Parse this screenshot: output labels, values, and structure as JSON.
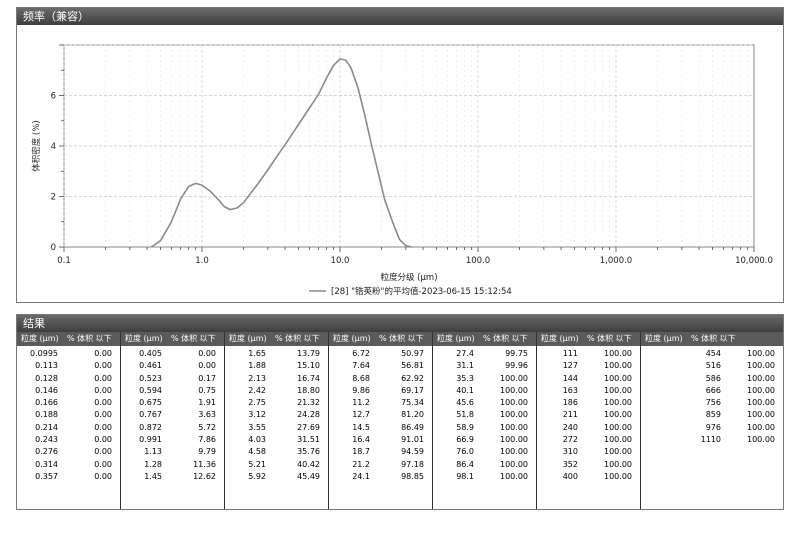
{
  "freq_panel": {
    "title": "频率（兼容）"
  },
  "chart_data": {
    "type": "line",
    "xscale": "log",
    "xlim": [
      0.1,
      10000.0
    ],
    "ylim": [
      0,
      8
    ],
    "xlabel": "粒度分级 (μm)",
    "ylabel": "体积密度 (%)",
    "x_ticks": [
      "0.1",
      "1.0",
      "10.0",
      "100.0",
      "1,000.0",
      "10,000.0"
    ],
    "y_ticks": [
      "0",
      "2",
      "4",
      "6"
    ],
    "grid": true,
    "legend": {
      "position": "bottom",
      "entries": [
        "[28] \"锆英粉\"的平均值-2023-06-15 15:12:54"
      ]
    },
    "series": [
      {
        "name": "[28] \"锆英粉\"的平均值-2023-06-15 15:12:54",
        "color": "#8a8a8a",
        "points": [
          [
            0.43,
            0
          ],
          [
            0.5,
            0.25
          ],
          [
            0.6,
            1.0
          ],
          [
            0.7,
            1.9
          ],
          [
            0.8,
            2.4
          ],
          [
            0.9,
            2.52
          ],
          [
            1.0,
            2.45
          ],
          [
            1.15,
            2.2
          ],
          [
            1.3,
            1.9
          ],
          [
            1.45,
            1.6
          ],
          [
            1.6,
            1.48
          ],
          [
            1.8,
            1.55
          ],
          [
            2.0,
            1.75
          ],
          [
            2.5,
            2.45
          ],
          [
            3.0,
            3.05
          ],
          [
            3.5,
            3.6
          ],
          [
            4.0,
            4.05
          ],
          [
            5.0,
            4.85
          ],
          [
            6.0,
            5.5
          ],
          [
            7.0,
            6.05
          ],
          [
            8.0,
            6.7
          ],
          [
            9.0,
            7.2
          ],
          [
            10.0,
            7.45
          ],
          [
            11.0,
            7.4
          ],
          [
            12.0,
            7.1
          ],
          [
            13.5,
            6.3
          ],
          [
            15.0,
            5.3
          ],
          [
            17.0,
            4.0
          ],
          [
            19.0,
            2.9
          ],
          [
            21.0,
            1.9
          ],
          [
            24.0,
            1.0
          ],
          [
            27.0,
            0.3
          ],
          [
            30.0,
            0.05
          ],
          [
            33.0,
            0
          ]
        ]
      }
    ]
  },
  "results": {
    "title": "结果",
    "col_size": "粒度 (μm)",
    "col_volume": "% 体积 以下",
    "columns": [
      [
        [
          "0.0995",
          "0.00"
        ],
        [
          "0.113",
          "0.00"
        ],
        [
          "0.128",
          "0.00"
        ],
        [
          "0.146",
          "0.00"
        ],
        [
          "0.166",
          "0.00"
        ],
        [
          "0.188",
          "0.00"
        ],
        [
          "0.214",
          "0.00"
        ],
        [
          "0.243",
          "0.00"
        ],
        [
          "0.276",
          "0.00"
        ],
        [
          "0.314",
          "0.00"
        ],
        [
          "0.357",
          "0.00"
        ]
      ],
      [
        [
          "0.405",
          "0.00"
        ],
        [
          "0.461",
          "0.00"
        ],
        [
          "0.523",
          "0.17"
        ],
        [
          "0.594",
          "0.75"
        ],
        [
          "0.675",
          "1.91"
        ],
        [
          "0.767",
          "3.63"
        ],
        [
          "0.872",
          "5.72"
        ],
        [
          "0.991",
          "7.86"
        ],
        [
          "1.13",
          "9.79"
        ],
        [
          "1.28",
          "11.36"
        ],
        [
          "1.45",
          "12.62"
        ]
      ],
      [
        [
          "1.65",
          "13.79"
        ],
        [
          "1.88",
          "15.10"
        ],
        [
          "2.13",
          "16.74"
        ],
        [
          "2.42",
          "18.80"
        ],
        [
          "2.75",
          "21.32"
        ],
        [
          "3.12",
          "24.28"
        ],
        [
          "3.55",
          "27.69"
        ],
        [
          "4.03",
          "31.51"
        ],
        [
          "4.58",
          "35.76"
        ],
        [
          "5.21",
          "40.42"
        ],
        [
          "5.92",
          "45.49"
        ]
      ],
      [
        [
          "6.72",
          "50.97"
        ],
        [
          "7.64",
          "56.81"
        ],
        [
          "8.68",
          "62.92"
        ],
        [
          "9.86",
          "69.17"
        ],
        [
          "11.2",
          "75.34"
        ],
        [
          "12.7",
          "81.20"
        ],
        [
          "14.5",
          "86.49"
        ],
        [
          "16.4",
          "91.01"
        ],
        [
          "18.7",
          "94.59"
        ],
        [
          "21.2",
          "97.18"
        ],
        [
          "24.1",
          "98.85"
        ]
      ],
      [
        [
          "27.4",
          "99.75"
        ],
        [
          "31.1",
          "99.96"
        ],
        [
          "35.3",
          "100.00"
        ],
        [
          "40.1",
          "100.00"
        ],
        [
          "45.6",
          "100.00"
        ],
        [
          "51.8",
          "100.00"
        ],
        [
          "58.9",
          "100.00"
        ],
        [
          "66.9",
          "100.00"
        ],
        [
          "76.0",
          "100.00"
        ],
        [
          "86.4",
          "100.00"
        ],
        [
          "98.1",
          "100.00"
        ]
      ],
      [
        [
          "111",
          "100.00"
        ],
        [
          "127",
          "100.00"
        ],
        [
          "144",
          "100.00"
        ],
        [
          "163",
          "100.00"
        ],
        [
          "186",
          "100.00"
        ],
        [
          "211",
          "100.00"
        ],
        [
          "240",
          "100.00"
        ],
        [
          "272",
          "100.00"
        ],
        [
          "310",
          "100.00"
        ],
        [
          "352",
          "100.00"
        ],
        [
          "400",
          "100.00"
        ]
      ],
      [
        [
          "454",
          "100.00"
        ],
        [
          "516",
          "100.00"
        ],
        [
          "586",
          "100.00"
        ],
        [
          "666",
          "100.00"
        ],
        [
          "756",
          "100.00"
        ],
        [
          "859",
          "100.00"
        ],
        [
          "976",
          "100.00"
        ],
        [
          "1110",
          "100.00"
        ]
      ]
    ]
  }
}
